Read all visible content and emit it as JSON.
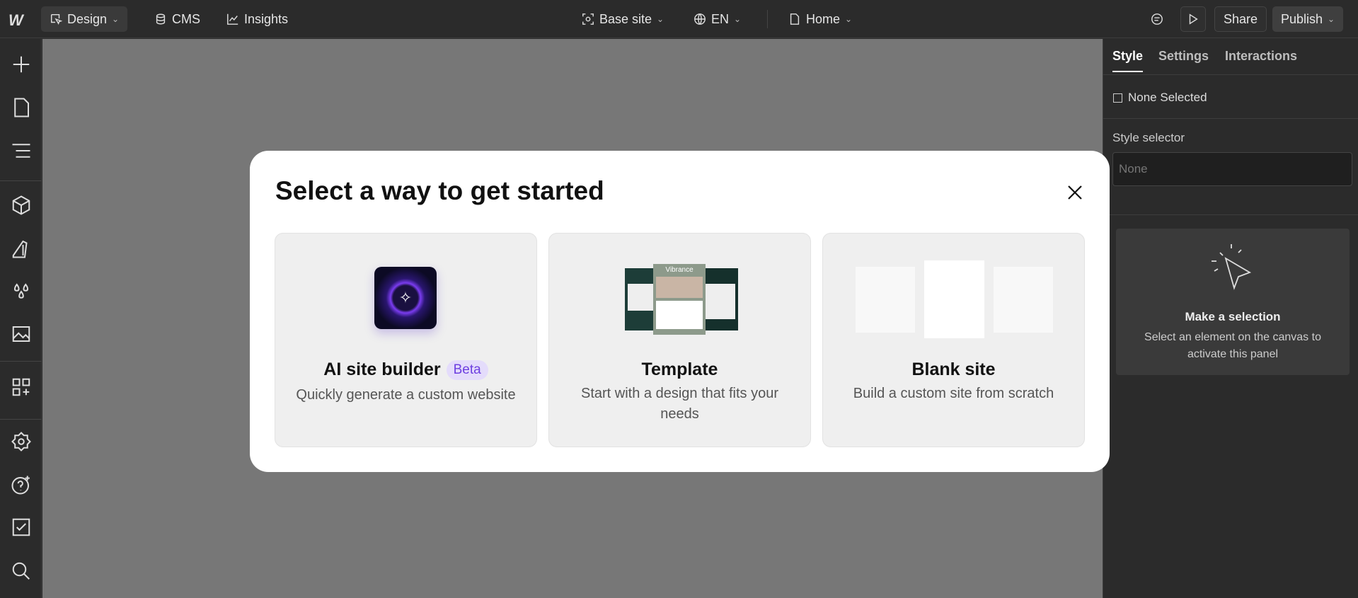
{
  "topbar": {
    "design": "Design",
    "cms": "CMS",
    "insights": "Insights",
    "base_site": "Base site",
    "locale": "EN",
    "page": "Home",
    "share": "Share",
    "publish": "Publish"
  },
  "panel": {
    "tabs": [
      "Style",
      "Settings",
      "Interactions"
    ],
    "none_selected": "None Selected",
    "style_selector_label": "Style selector",
    "style_selector_placeholder": "None",
    "selection_title": "Make a selection",
    "selection_desc": "Select an element on the canvas to activate this panel"
  },
  "modal": {
    "title": "Select a way to get started",
    "cards": [
      {
        "title": "AI site builder",
        "badge": "Beta",
        "desc": "Quickly generate a custom website"
      },
      {
        "title": "Template",
        "desc": "Start with a design that fits your needs",
        "thumb_text": "Vibrance"
      },
      {
        "title": "Blank site",
        "desc": "Build a custom site from scratch"
      }
    ]
  },
  "colors": {
    "accent": "#6d3fe0",
    "canvas": "#777777",
    "panel": "#2b2b2b"
  }
}
